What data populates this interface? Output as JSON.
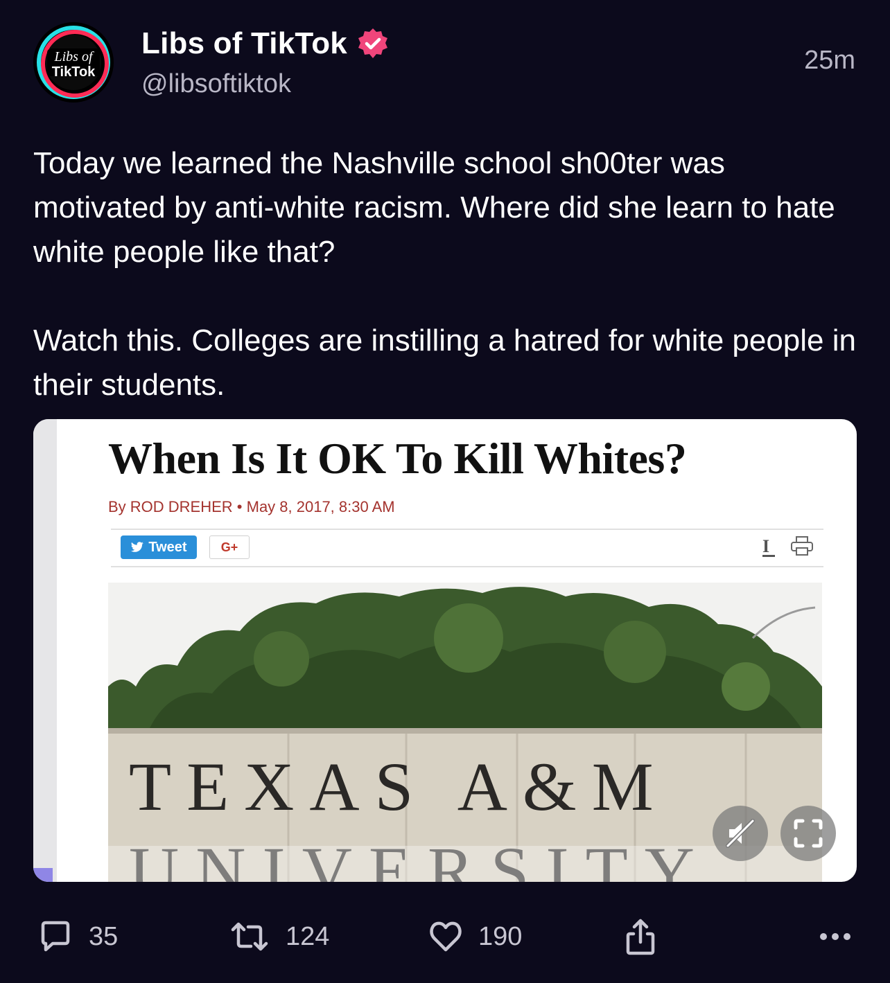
{
  "author": {
    "display_name": "Libs of TikTok",
    "handle": "@libsoftiktok",
    "avatar_text_line1": "Libs of",
    "avatar_text_line2": "TikTok",
    "verified_icon": "verified-badge-icon"
  },
  "timestamp": "25m",
  "post": {
    "paragraph_1": "Today we learned the Nashville school sh00ter was motivated by anti-white racism. Where did she learn to hate white people like that?",
    "paragraph_2": "Watch this. Colleges are instilling a hatred for white people in their students."
  },
  "media": {
    "article_title": "When Is It OK To Kill Whites?",
    "article_byline": "By ROD DREHER • May 8, 2017, 8:30 AM",
    "tweet_label": "Tweet",
    "gplus_label": "G+",
    "font_size_label": "I",
    "sign_line_1": "TEXAS A&M",
    "sign_line_2": "UNIVERSITY",
    "mute_icon": "mute-icon",
    "fullscreen_icon": "fullscreen-icon"
  },
  "actions": {
    "replies": "35",
    "reposts": "124",
    "likes": "190"
  },
  "colors": {
    "background": "#0c0a1c",
    "accent": "#f0457b",
    "muted_text": "#b9b7c6"
  }
}
